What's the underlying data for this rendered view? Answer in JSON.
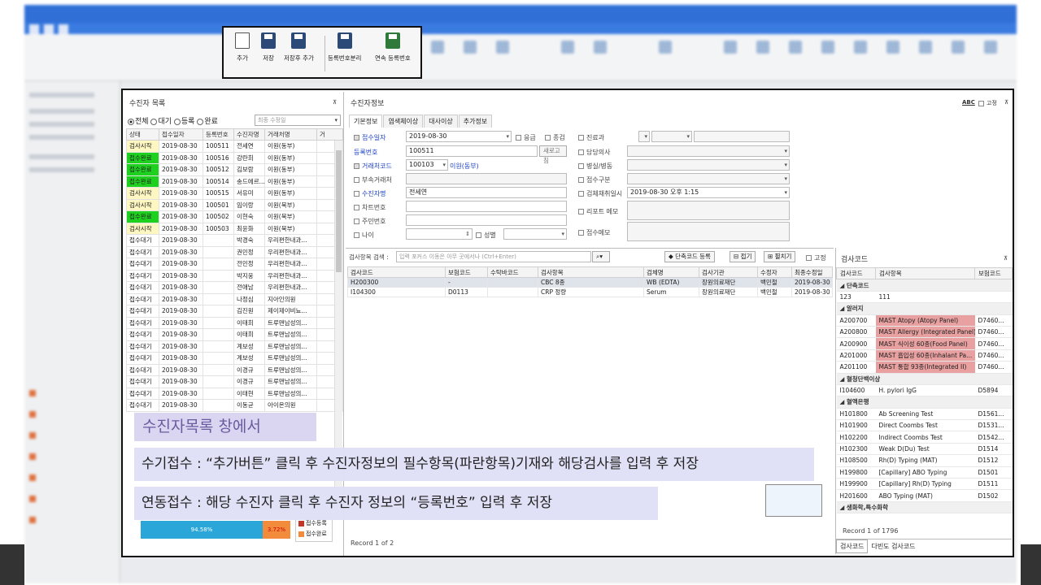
{
  "toolbar": {
    "buttons": [
      {
        "label": "추가",
        "icon": "new-document-icon"
      },
      {
        "label": "저장",
        "icon": "save-icon"
      },
      {
        "label": "저장후 추가",
        "icon": "save-add-icon"
      },
      {
        "label": "등록번호분리",
        "icon": "split-register-icon"
      },
      {
        "label": "연속 등록번호",
        "icon": "continuous-register-icon"
      }
    ]
  },
  "patient_list": {
    "title": "수진자 목록",
    "filters": {
      "all": "전체",
      "waiting": "대기",
      "registered": "등록",
      "done": "완료"
    },
    "sort_placeholder": "최종 수정일",
    "columns": [
      "상태",
      "접수일자",
      "등록번호",
      "수진자명",
      "거래처명",
      "거"
    ],
    "rows": [
      {
        "status": "검사시작",
        "date": "2019-08-30",
        "reg": "100511",
        "name": "전세연",
        "client": "이원(동부)",
        "color": "yellow"
      },
      {
        "status": "접수완료",
        "date": "2019-08-30",
        "reg": "100516",
        "name": "강란희",
        "client": "이원(동부)",
        "color": "green"
      },
      {
        "status": "접수완료",
        "date": "2019-08-30",
        "reg": "100512",
        "name": "김보람",
        "client": "이원(동부)",
        "color": "green"
      },
      {
        "status": "접수완료",
        "date": "2019-08-30",
        "reg": "100514",
        "name": "송드에르...",
        "client": "이원(동부)",
        "color": "green"
      },
      {
        "status": "검사시작",
        "date": "2019-08-30",
        "reg": "100515",
        "name": "서유미",
        "client": "이원(동부)",
        "color": "yellow"
      },
      {
        "status": "검사시작",
        "date": "2019-08-30",
        "reg": "100501",
        "name": "임이랑",
        "client": "이원(북부)",
        "color": "yellow"
      },
      {
        "status": "접수완료",
        "date": "2019-08-30",
        "reg": "100502",
        "name": "이현숙",
        "client": "이원(북부)",
        "color": "green"
      },
      {
        "status": "검사시작",
        "date": "2019-08-30",
        "reg": "100503",
        "name": "최윤화",
        "client": "이원(북부)",
        "color": "yellow"
      },
      {
        "status": "접수대기",
        "date": "2019-08-30",
        "reg": "",
        "name": "박경숙",
        "client": "우리편한내과...",
        "color": ""
      },
      {
        "status": "접수대기",
        "date": "2019-08-30",
        "reg": "",
        "name": "권민정",
        "client": "우리편한내과...",
        "color": ""
      },
      {
        "status": "접수대기",
        "date": "2019-08-30",
        "reg": "",
        "name": "전민정",
        "client": "우리편한내과...",
        "color": ""
      },
      {
        "status": "접수대기",
        "date": "2019-08-30",
        "reg": "",
        "name": "박지웅",
        "client": "우리편한내과...",
        "color": ""
      },
      {
        "status": "접수대기",
        "date": "2019-08-30",
        "reg": "",
        "name": "전애남",
        "client": "우리편한내과...",
        "color": ""
      },
      {
        "status": "접수대기",
        "date": "2019-08-30",
        "reg": "",
        "name": "나정심",
        "client": "지아인의원",
        "color": ""
      },
      {
        "status": "접수대기",
        "date": "2019-08-30",
        "reg": "",
        "name": "김진원",
        "client": "제이제이비뇨...",
        "color": ""
      },
      {
        "status": "접수대기",
        "date": "2019-08-30",
        "reg": "",
        "name": "이태희",
        "client": "트루맨남성의...",
        "color": ""
      },
      {
        "status": "접수대기",
        "date": "2019-08-30",
        "reg": "",
        "name": "이태희",
        "client": "트루맨남성의...",
        "color": ""
      },
      {
        "status": "접수대기",
        "date": "2019-08-30",
        "reg": "",
        "name": "계보성",
        "client": "트루맨남성의...",
        "color": ""
      },
      {
        "status": "접수대기",
        "date": "2019-08-30",
        "reg": "",
        "name": "계보성",
        "client": "트루맨남성의...",
        "color": ""
      },
      {
        "status": "접수대기",
        "date": "2019-08-30",
        "reg": "",
        "name": "이경규",
        "client": "트루맨남성의...",
        "color": ""
      },
      {
        "status": "접수대기",
        "date": "2019-08-30",
        "reg": "",
        "name": "이경규",
        "client": "트루맨남성의...",
        "color": ""
      },
      {
        "status": "접수대기",
        "date": "2019-08-30",
        "reg": "",
        "name": "이태현",
        "client": "트루맨남성의...",
        "color": ""
      },
      {
        "status": "접수대기",
        "date": "2019-08-30",
        "reg": "",
        "name": "이동균",
        "client": "아이온의원",
        "color": ""
      }
    ],
    "chart": {
      "pct_a": "94.58%",
      "pct_b": "3.72%",
      "legend": [
        "접수등록",
        "접수완료"
      ],
      "colors": [
        "#2aa7d8",
        "#f28c3c",
        "#c0392b"
      ]
    }
  },
  "patient_info": {
    "title": "수진자정보",
    "header_right": {
      "abc": "ABC",
      "fixed": "고정"
    },
    "tabs": [
      "기본정보",
      "염색체이상",
      "대사이상",
      "추가정보"
    ],
    "fields": {
      "receipt_date_label": "접수일자",
      "receipt_date": "2019-08-30",
      "urgent": "응급",
      "final": "종검",
      "reg_no_label": "등록번호",
      "reg_no": "100511",
      "new_reg_btn": "새로고침",
      "client_code_label": "거래처코드",
      "client_code": "100103",
      "client_name": "이원(동부)",
      "sub_client_label": "부속거래처",
      "patient_name_label": "수진자명",
      "patient_name": "전세연",
      "chart_no_label": "차트번호",
      "resident_no_label": "주민번호",
      "age_label": "나이",
      "gender_label": "성별",
      "dept_label": "진료과",
      "doctor_label": "담당의사",
      "ward_label": "병실/병동",
      "receipt_type_label": "접수구분",
      "sample_time_label": "검체채취일시",
      "sample_time": "2019-08-30 오후 1:15",
      "report_memo_label": "리포트 메모",
      "receipt_memo_label": "접수메모"
    }
  },
  "tests": {
    "search_label": "검사항목 검색 :",
    "search_placeholder": "입력 포커스 이동은 아무 곳에서나 (Ctrl+Enter)",
    "btn_shortcode": "단축코드 등록",
    "btn_collapse": "접기",
    "btn_expand": "펼치기",
    "fixed": "고정",
    "columns": [
      "검사코드",
      "보험코드",
      "수탁바코드",
      "검사항목",
      "검체명",
      "검사기관",
      "수정자",
      "최종수정일"
    ],
    "rows": [
      {
        "code": "H200300",
        "ins": "-",
        "barcode": "",
        "item": "CBC 8종",
        "specimen": "WB (EDTA)",
        "org": "장원의료재단",
        "editor": "백민철",
        "date": "2019-08-30"
      },
      {
        "code": "I104300",
        "ins": "D0113",
        "barcode": "",
        "item": "CRP 정량",
        "specimen": "Serum",
        "org": "장원의료재단",
        "editor": "백민철",
        "date": "2019-08-30"
      }
    ],
    "record": "Record 1 of 2"
  },
  "codes": {
    "title": "검사코드",
    "columns": [
      "검사코드",
      "검사항목",
      "보험코드"
    ],
    "groups": [
      {
        "name": "단축코드",
        "rows": [
          {
            "code": "123",
            "item": "111",
            "ins": "",
            "pink": false
          }
        ]
      },
      {
        "name": "알러지",
        "rows": [
          {
            "code": "A200700",
            "item": "MAST Atopy (Atopy Panel)",
            "ins": "D7460...",
            "pink": true
          },
          {
            "code": "A200800",
            "item": "MAST Allergy (Integrated Panel)",
            "ins": "D7460...",
            "pink": true
          },
          {
            "code": "A200900",
            "item": "MAST 식이성 60종(Food Panel)",
            "ins": "D7460...",
            "pink": true
          },
          {
            "code": "A201000",
            "item": "MAST 흡입성 60종(Inhalant Pa...",
            "ins": "D7460...",
            "pink": true
          },
          {
            "code": "A201100",
            "item": "MAST 통합 93종(Integrated II)",
            "ins": "D7460...",
            "pink": true
          }
        ]
      },
      {
        "name": "혈청단백이상",
        "rows": [
          {
            "code": "I104600",
            "item": "H. pylori IgG",
            "ins": "D5894",
            "pink": false
          }
        ]
      },
      {
        "name": "혈액은행",
        "rows": [
          {
            "code": "H101800",
            "item": "Ab Screening Test",
            "ins": "D1561...",
            "pink": false
          },
          {
            "code": "H101900",
            "item": "Direct Coombs Test",
            "ins": "D1531...",
            "pink": false
          },
          {
            "code": "H102200",
            "item": "Indirect Coombs Test",
            "ins": "D1542...",
            "pink": false
          },
          {
            "code": "H102300",
            "item": "Weak D(Du) Test",
            "ins": "D1514",
            "pink": false
          },
          {
            "code": "H108500",
            "item": "Rh(D) Typing (MAT)",
            "ins": "D1512",
            "pink": false
          },
          {
            "code": "H199800",
            "item": "[Capillary] ABO Typing",
            "ins": "D1501",
            "pink": false
          },
          {
            "code": "H199900",
            "item": "[Capillary] Rh(D) Typing",
            "ins": "D1511",
            "pink": false
          },
          {
            "code": "H201600",
            "item": "ABO Typing (MAT)",
            "ins": "D1502",
            "pink": false
          }
        ]
      },
      {
        "name": "생화학,특수화학",
        "rows": []
      }
    ],
    "record": "Record 1 of 1796",
    "tabs": [
      "검사코드",
      "다빈도 검사코드"
    ]
  },
  "overlays": {
    "caption1": "수진자목록 창에서",
    "caption2": "수기접수 : “추가버튼” 클릭 후 수진자정보의 필수항목(파란항목)기재와 해당검사를 입력 후 저장",
    "caption3": "연동접수 : 해당 수진자 클릭 후 수진자 정보의 “등록번호” 입력 후 저장"
  }
}
